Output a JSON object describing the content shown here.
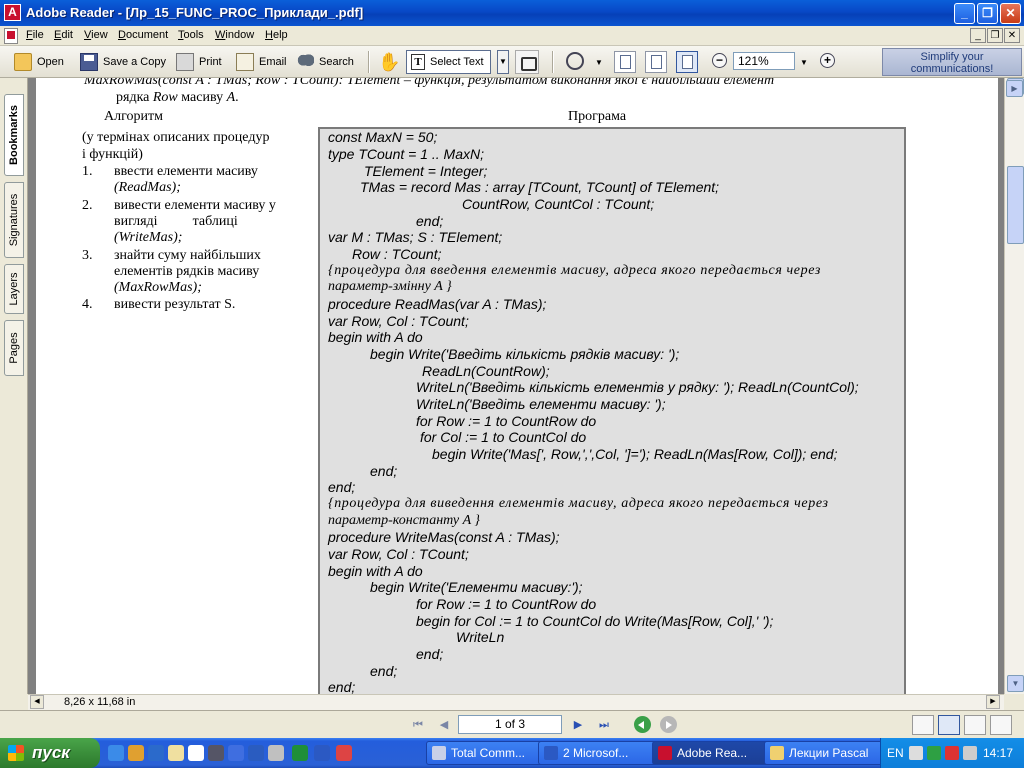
{
  "window": {
    "title": "Adobe Reader - [Лр_15_FUNC_PROC_Приклади_.pdf]",
    "app_icon_letter": "A"
  },
  "menu": [
    "File",
    "Edit",
    "View",
    "Document",
    "Tools",
    "Window",
    "Help"
  ],
  "toolbar": {
    "open": "Open",
    "save_copy": "Save a Copy",
    "print": "Print",
    "email": "Email",
    "search": "Search",
    "select_text": "Select Text",
    "zoom": "121%",
    "promo_line1": "Simplify your",
    "promo_line2": "communications!"
  },
  "nav_tabs": [
    "Bookmarks",
    "Signatures",
    "Layers",
    "Pages"
  ],
  "document": {
    "top_line1": "MaxRowMas(const A : TMas; Row : TCount): TElement – функція, результатом виконання якої є найбільший елемент",
    "top_line2_a": "рядка ",
    "top_line2_b": "Row",
    "top_line2_c": " масиву ",
    "top_line2_d": "A",
    "top_line2_e": ".",
    "algo_header": "Алгоритм",
    "program_header": "Програма",
    "algo_intro1": "(у термінах описаних процедур",
    "algo_intro2": "і функцій)",
    "steps": [
      {
        "num": "1.",
        "l1": "ввести елементи масиву",
        "l2": "(ReadMas);"
      },
      {
        "num": "2.",
        "l1": "вивести елементи масиву у",
        "l2": "вигляді          таблиці",
        "l3": "(WriteMas);"
      },
      {
        "num": "3.",
        "l1": "знайти суму найбільших",
        "l2": "елементів рядків масиву",
        "l3": "(MaxRowMas);"
      },
      {
        "num": "4.",
        "l1": "вивести результат S."
      }
    ],
    "code": [
      "const MaxN = 50;",
      "type  TCount = 1 .. MaxN;",
      "TElement = Integer;",
      "TMas = record Mas : array [TCount, TCount] of TElement;",
      "CountRow, CountCol : TCount;",
      "end;",
      "var M : TMas; S : TElement;",
      "Row : TCount;",
      "{процедура для введення елементів масиву, адреса якого передається через",
      "параметр-змінну A }",
      "procedure ReadMas(var A : TMas);",
      "var Row, Col : TCount;",
      "begin with A do",
      "begin  Write('Введіть кількість рядків масиву: ');",
      "ReadLn(CountRow);",
      "WriteLn('Введіть кількість елементів у рядку: '); ReadLn(CountCol);",
      "WriteLn('Введіть елементи масиву: ');",
      "for Row := 1 to CountRow do",
      "for Col := 1 to CountCol do",
      "begin Write('Mas[', Row,',',Col, ']='); ReadLn(Mas[Row, Col]); end;",
      "end;",
      "end;",
      "{процедура для виведення елементів масиву, адреса якого передається через",
      "параметр-константу A }",
      "procedure WriteMas(const A : TMas);",
      "var Row, Col : TCount;",
      "begin with A do",
      "begin Write('Елементи масиву:');",
      "for Row := 1 to CountRow do",
      "begin for Col := 1 to CountCol do Write(Mas[Row, Col],' ');",
      "WriteLn",
      "end;",
      "end;",
      "end;"
    ]
  },
  "page_size": "8,26 x 11,68 in",
  "page_indicator": "1 of 3",
  "taskbar": {
    "start": "пуск",
    "tasks": [
      "Total Comm...",
      "2 Microsof...",
      "Adobe Rea...",
      "Лекции Pascal"
    ],
    "lang": "EN",
    "clock": "14:17"
  },
  "colors": {
    "title_blue": "#0848c6",
    "code_bg": "#e0e0e0",
    "taskbar_blue": "#245edc",
    "start_green": "#3a8e3a"
  }
}
